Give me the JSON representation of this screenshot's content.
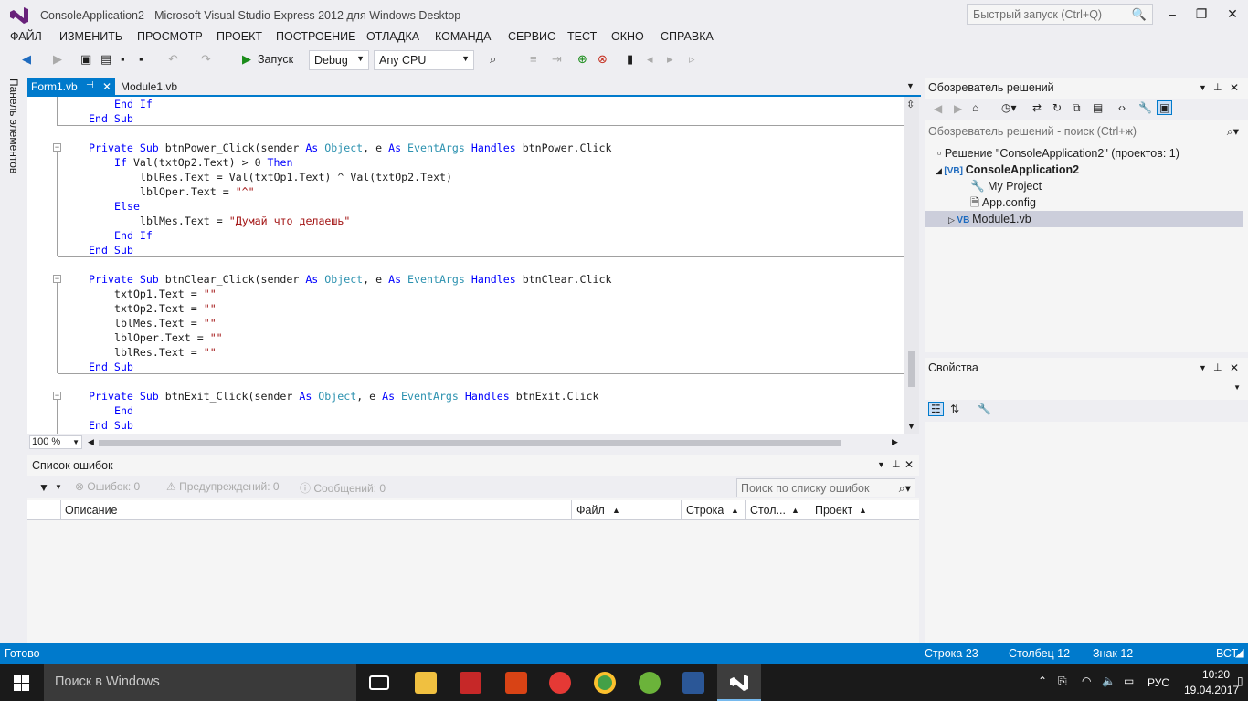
{
  "window": {
    "title": "ConsoleApplication2 - Microsoft Visual Studio Express 2012 для Windows Desktop",
    "quick_launch_placeholder": "Быстрый запуск (Ctrl+Q)"
  },
  "menu": [
    "ФАЙЛ",
    "ИЗМЕНИТЬ",
    "ПРОСМОТР",
    "ПРОЕКТ",
    "ПОСТРОЕНИЕ",
    "ОТЛАДКА",
    "КОМАНДА",
    "СЕРВИС",
    "ТЕСТ",
    "ОКНО",
    "СПРАВКА"
  ],
  "toolbar": {
    "run_label": "Запуск",
    "config": "Debug",
    "platform": "Any CPU"
  },
  "toolbox_tab": "Панель элементов",
  "tabs": [
    {
      "label": "Form1.vb",
      "active": true
    },
    {
      "label": "Module1.vb",
      "active": false
    }
  ],
  "code": {
    "lines": [
      "End If",
      "End Sub",
      "Private Sub btnPower_Click(sender As Object, e As EventArgs) Handles btnPower.Click",
      "If Val(txtOp2.Text) > 0 Then",
      "lblRes.Text = Val(txtOp1.Text) ^ Val(txtOp2.Text)",
      "lblOper.Text = \"^\"",
      "Else",
      "lblMes.Text = \"Думай что делаешь\"",
      "End If",
      "End Sub",
      "Private Sub btnClear_Click(sender As Object, e As EventArgs) Handles btnClear.Click",
      "txtOp1.Text = \"\"",
      "txtOp2.Text = \"\"",
      "lblMes.Text = \"\"",
      "lblOper.Text = \"\"",
      "lblRes.Text = \"\"",
      "End Sub",
      "Private Sub btnExit_Click(sender As Object, e As EventArgs) Handles btnExit.Click",
      "End",
      "End Sub"
    ]
  },
  "zoom": "100 %",
  "error_list": {
    "title": "Список ошибок",
    "errors": "Ошибок: 0",
    "warnings": "Предупреждений: 0",
    "messages": "Сообщений: 0",
    "search_placeholder": "Поиск по списку ошибок",
    "columns": [
      "Описание",
      "Файл",
      "Строка",
      "Стол...",
      "Проект"
    ]
  },
  "solution_explorer": {
    "title": "Обозреватель решений",
    "search_placeholder": "Обозреватель решений - поиск (Ctrl+ж)",
    "items": [
      "Решение \"ConsoleApplication2\"  (проектов: 1)",
      "ConsoleApplication2",
      "My Project",
      "App.config",
      "Module1.vb"
    ]
  },
  "properties": {
    "title": "Свойства"
  },
  "status": {
    "ready": "Готово",
    "line": "Строка 23",
    "col": "Столбец 12",
    "ch": "Знак 12",
    "mode": "ВСТ"
  },
  "taskbar": {
    "search": "Поиск в Windows",
    "lang": "РУС",
    "time": "10:20",
    "date": "19.04.2017"
  },
  "colors": {
    "accent": "#007acc",
    "keyword": "#0000ff",
    "type": "#2b91af",
    "string": "#a31515"
  }
}
